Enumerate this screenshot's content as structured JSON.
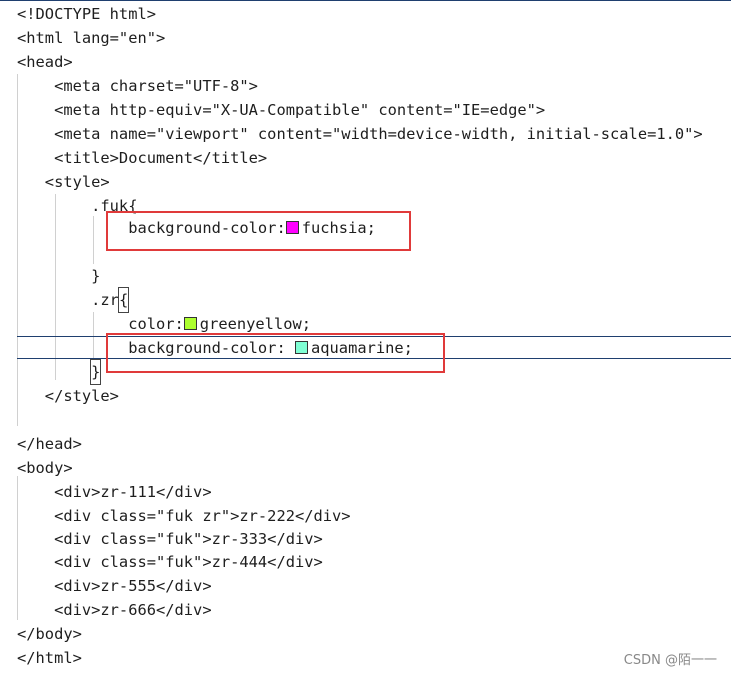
{
  "editor": {
    "lines": [
      "<!DOCTYPE html>",
      "<html lang=\"en\">",
      "<head>",
      "    <meta charset=\"UTF-8\">",
      "    <meta http-equiv=\"X-UA-Compatible\" content=\"IE=edge\">",
      "    <meta name=\"viewport\" content=\"width=device-width, initial-scale=1.0\">",
      "    <title>Document</title>",
      "   <style>",
      "        .fuk{",
      "            background-color:",
      "",
      "        }",
      "        .zr",
      "            color:",
      "            background-color:",
      "        ",
      "   </style>",
      "",
      "</head>",
      "<body>",
      "    <div>zr-111</div>",
      "    <div class=\"fuk zr\">zr-222</div>",
      "    <div class=\"fuk\">zr-333</div>",
      "    <div class=\"fuk\">zr-444</div>",
      "    <div>zr-555</div>",
      "    <div>zr-666</div>",
      "</body>",
      "</html>"
    ],
    "brace_open": "{",
    "brace_close": "}",
    "values": {
      "fuk_bg": "fuchsia;",
      "zr_color": "greenyellow;",
      "zr_bg": "aquamarine;"
    },
    "swatch_colors": {
      "fuchsia": "#ff00ff",
      "greenyellow": "#adff2f",
      "aquamarine": "#7fffd4"
    }
  },
  "watermark": "CSDN @陌一一",
  "highlight_color": "#e03a3a"
}
